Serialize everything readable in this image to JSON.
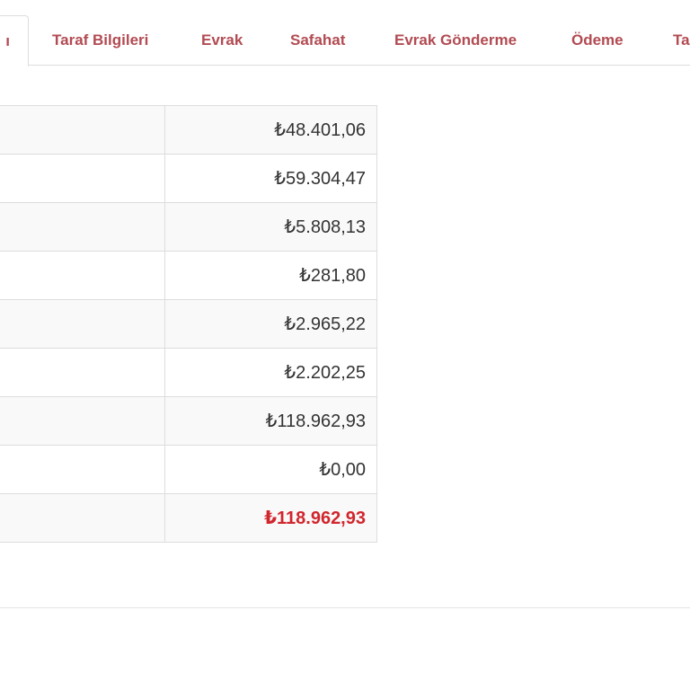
{
  "tabs": [
    {
      "label": "ı",
      "active": true
    },
    {
      "label": "Taraf Bilgileri",
      "active": false
    },
    {
      "label": "Evrak",
      "active": false
    },
    {
      "label": "Safahat",
      "active": false
    },
    {
      "label": "Evrak Gönderme",
      "active": false
    },
    {
      "label": "Ödeme",
      "active": false
    },
    {
      "label": "Ta",
      "active": false
    }
  ],
  "amounts": [
    {
      "value": "₺48.401,06"
    },
    {
      "value": "₺59.304,47"
    },
    {
      "value": "₺5.808,13"
    },
    {
      "value": "₺281,80"
    },
    {
      "value": "₺2.965,22"
    },
    {
      "value": "₺2.202,25"
    },
    {
      "value": "₺118.962,93"
    },
    {
      "value": "₺0,00"
    }
  ],
  "total": {
    "value": "₺118.962,93"
  },
  "colors": {
    "tab_text": "#b24b52",
    "total_text": "#d0262d",
    "border": "#dddddd",
    "stripe": "#f9f9f9"
  }
}
